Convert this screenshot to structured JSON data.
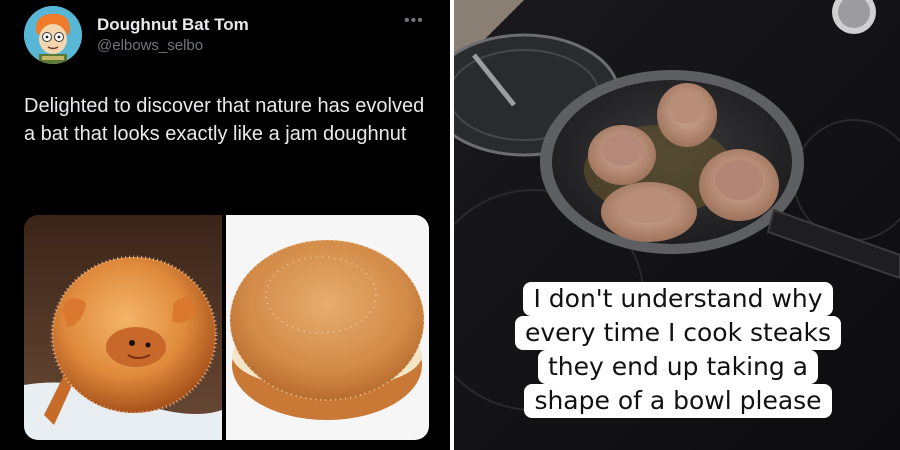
{
  "tweet": {
    "display_name": "Doughnut Bat Tom",
    "handle": "@elbows_selbo",
    "more_icon": "more-horizontal-icon",
    "text": "Delighted to discover that nature has evolved a bat that looks exactly like a jam doughnut"
  },
  "meme": {
    "caption_lines": [
      "I don't understand why",
      "every time I cook steaks",
      "they end up taking a",
      "shape of a bowl please"
    ]
  },
  "colors": {
    "tweet_bg": "#000000",
    "name": "#e7e9ea",
    "handle": "#71767b"
  }
}
